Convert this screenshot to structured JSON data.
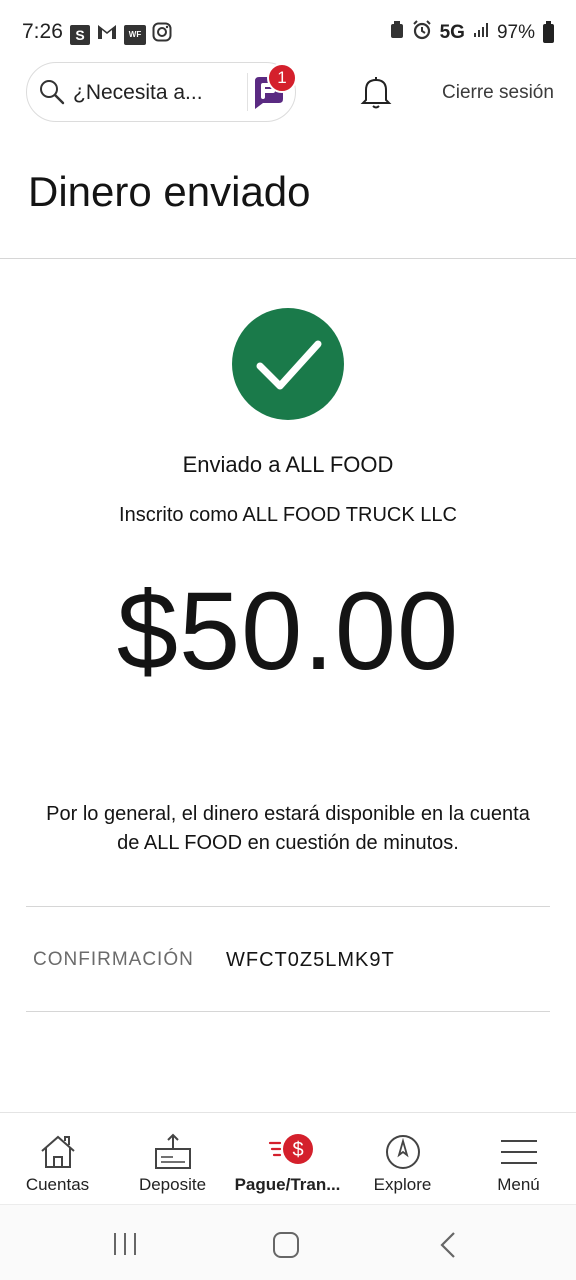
{
  "status_bar": {
    "time": "7:26",
    "notif_icons": [
      "S",
      "M",
      "WF",
      "instagram-icon"
    ],
    "network": "5G",
    "battery": "97%"
  },
  "header": {
    "search_placeholder": "¿Necesita a...",
    "fargo_badge": "1",
    "logout_label": "Cierre sesión"
  },
  "page": {
    "title": "Dinero enviado"
  },
  "confirmation": {
    "sent_to": "Enviado a ALL FOOD",
    "enrolled_as": "Inscrito como ALL FOOD TRUCK LLC",
    "amount": "$50.00",
    "notice": "Por lo general, el dinero estará disponible en la cuenta de ALL FOOD en cuestión de minutos.",
    "confirmation_label": "CONFIRMACIÓN",
    "confirmation_value": "WFCT0Z5LMK9T"
  },
  "bottom_nav": {
    "items": [
      {
        "label": "Cuentas",
        "icon": "home-icon"
      },
      {
        "label": "Deposite",
        "icon": "deposit-icon"
      },
      {
        "label": "Pague/Tran...",
        "icon": "pay-transfer-icon"
      },
      {
        "label": "Explore",
        "icon": "compass-icon"
      },
      {
        "label": "Menú",
        "icon": "hamburger-menu-icon"
      }
    ]
  },
  "colors": {
    "success_green": "#1a7a4a",
    "accent_red": "#d4202c",
    "fargo_purple": "#5a2a82"
  }
}
